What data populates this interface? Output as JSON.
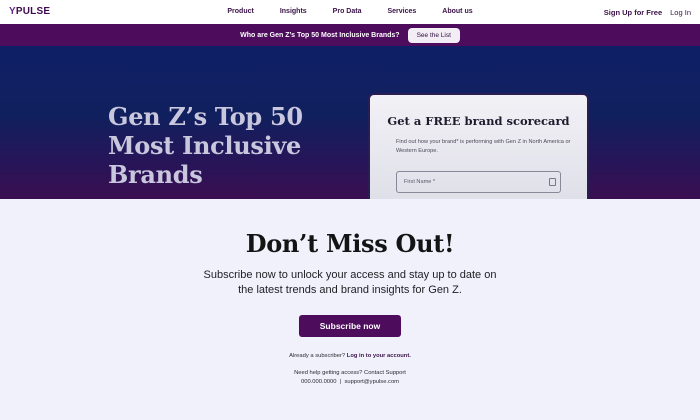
{
  "nav": {
    "logo": "YPULSE",
    "logo_mark": "Y",
    "logo_rest": "PULSE",
    "links": [
      "Product",
      "Insights",
      "Pro Data",
      "Services",
      "About us"
    ],
    "signup": "Sign Up for Free",
    "login": "Log In"
  },
  "banner": {
    "text": "Who are Gen Z’s Top 50 Most Inclusive Brands?",
    "button": "See the List"
  },
  "hero": {
    "title_line1": "Gen Z’s Top 50",
    "title_line2": "Most Inclusive",
    "title_line3": "Brands",
    "card": {
      "title": "Get a FREE brand scorecard",
      "description": "Find out how your brand* is performing with Gen Z in North America or Western Europe.",
      "first_name_placeholder": "First Name *",
      "field_icon": "contact-card-icon"
    }
  },
  "subscribe": {
    "title": "Don’t Miss Out!",
    "description": "Subscribe now to unlock your access and stay up to date on the latest trends and brand insights for Gen Z.",
    "button": "Subscribe now",
    "already_prefix": "Already a subscriber?",
    "login_link": "Log in to your account.",
    "help_line": "Need help getting access? Contact Support",
    "phone": "000.000.0000",
    "separator": "|",
    "email": "support@ypulse.com"
  },
  "colors": {
    "brand_purple": "#4d0d5c",
    "hero_navy": "#0f1f66",
    "background": "#f0f1fb"
  }
}
